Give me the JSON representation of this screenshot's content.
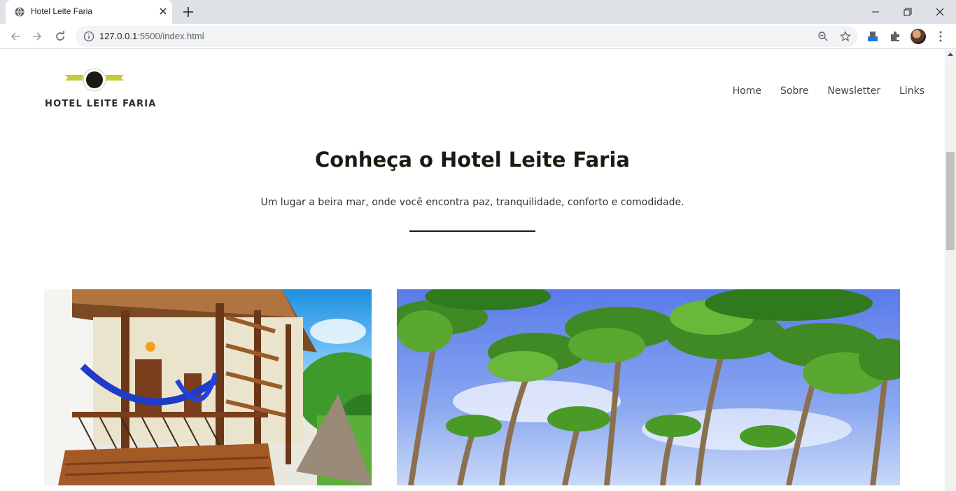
{
  "browser": {
    "tab_title": "Hotel Leite Faria",
    "url_host": "127.0.0.1",
    "url_path": ":5500/index.html"
  },
  "site": {
    "logo_text": "HOTEL LEITE FARIA",
    "nav": [
      "Home",
      "Sobre",
      "Newsletter",
      "Links"
    ],
    "headline": "Conheça o Hotel Leite Faria",
    "subheadline": "Um lugar a beira mar, onde você encontra paz, tranquilidade, conforto e comodidade."
  },
  "colors": {
    "logo_accent": "#c5c93a",
    "heading": "#1b1a10",
    "chrome_tabbar": "#dee1e6"
  },
  "icons": [
    "globe-icon",
    "close-icon",
    "plus-icon",
    "minimize-icon",
    "restore-icon",
    "back-icon",
    "forward-icon",
    "reload-icon",
    "info-icon",
    "zoom-icon",
    "star-icon",
    "extension-icon",
    "puzzle-icon",
    "menu-icon"
  ]
}
